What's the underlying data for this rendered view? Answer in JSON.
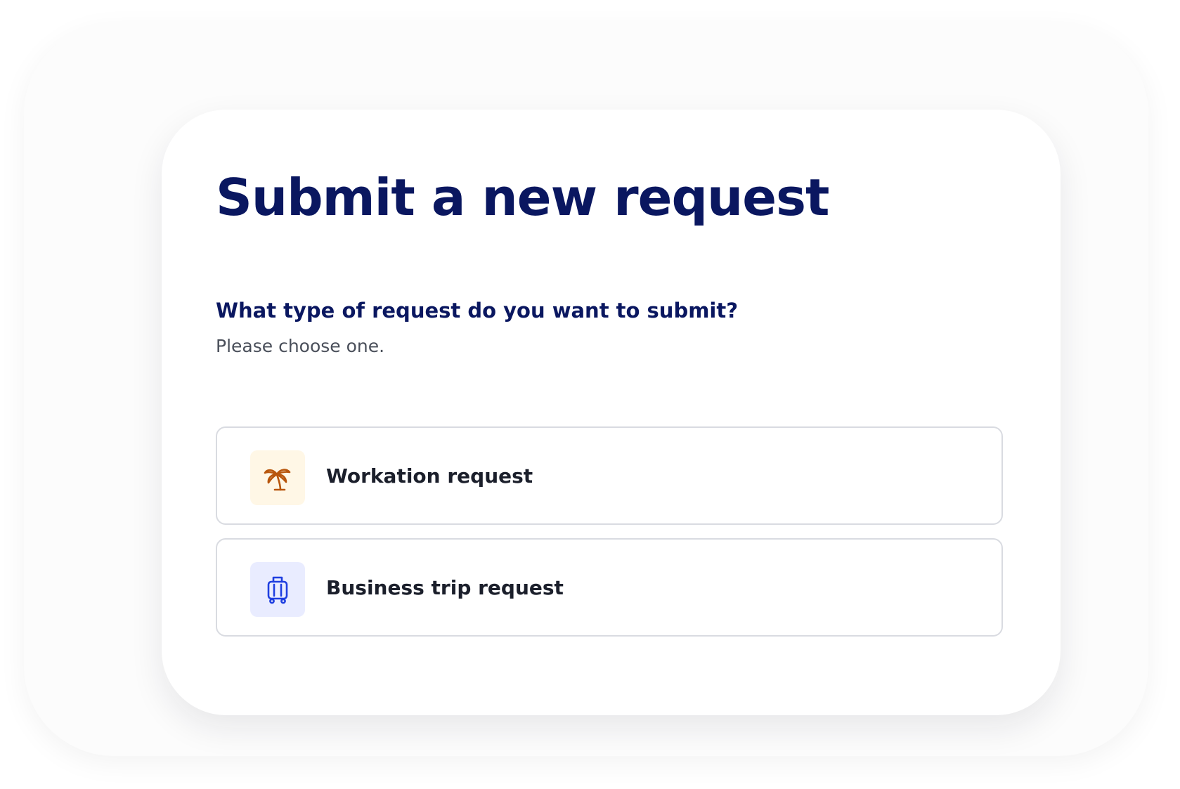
{
  "page": {
    "title": "Submit a new request",
    "question": "What type of request do you want to submit?",
    "hint": "Please choose one."
  },
  "options": [
    {
      "label": "Workation request",
      "icon": "palm-tree-icon",
      "icon_color": "#b8560c",
      "icon_bg": "#fff7e6"
    },
    {
      "label": "Business trip request",
      "icon": "luggage-icon",
      "icon_color": "#1f3fe0",
      "icon_bg": "#e9ecff"
    }
  ],
  "colors": {
    "title": "#0a1760",
    "text": "#1b1f2b",
    "muted": "#4a4f5a",
    "border": "#d9dbe1"
  }
}
